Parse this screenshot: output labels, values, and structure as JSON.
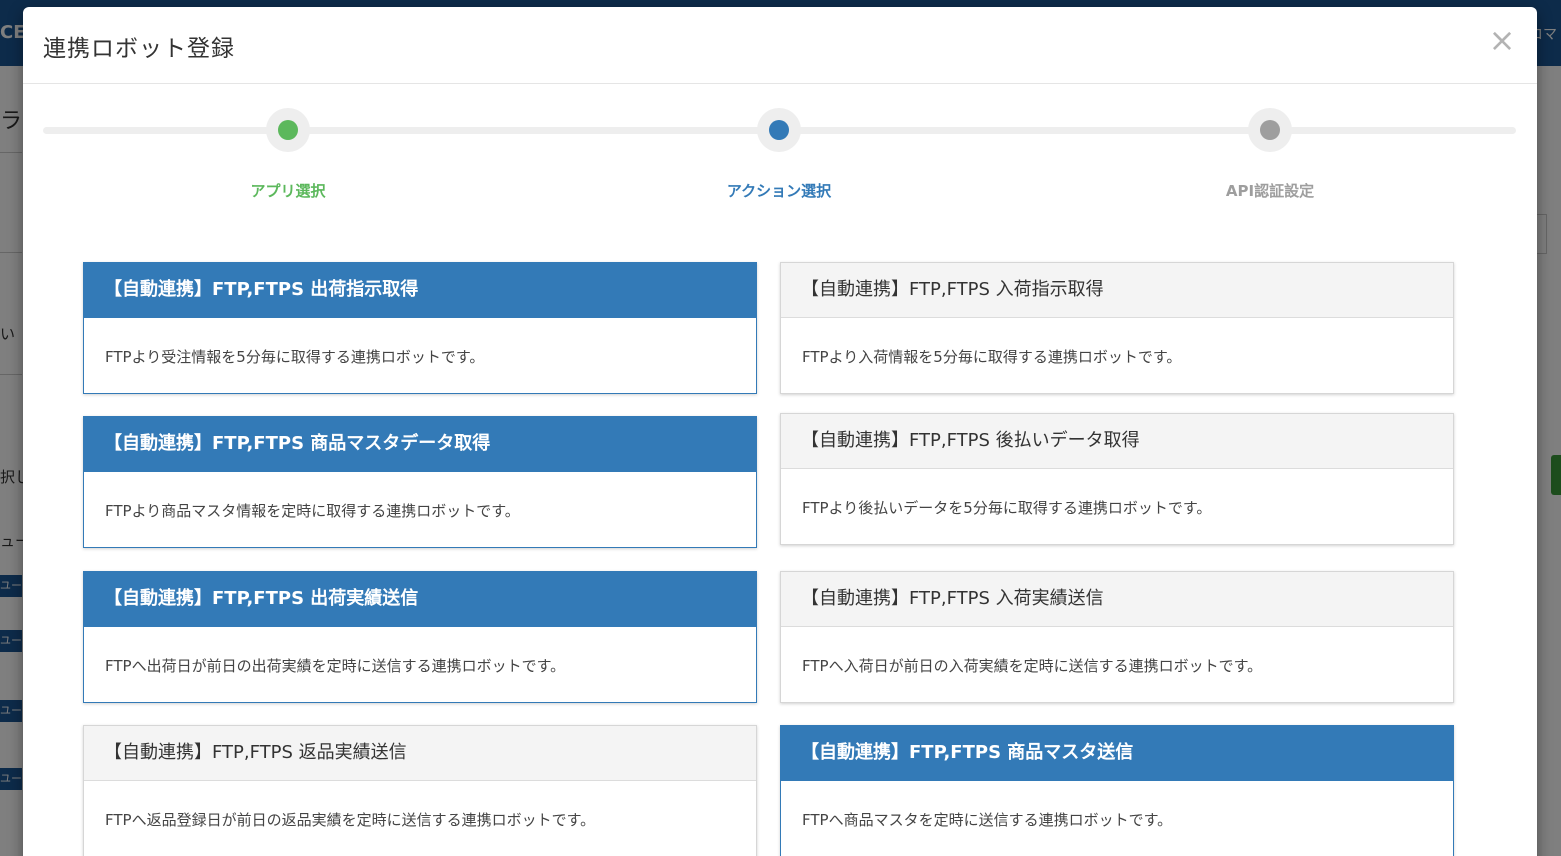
{
  "background": {
    "brand_fragment": "CE",
    "topbar_right_fragment": "コマ",
    "left_fragments": [
      "ラ",
      "い",
      "択し",
      "ュー"
    ],
    "left_badge_fragment": "ユー"
  },
  "modal": {
    "title": "連携ロボット登録",
    "close_glyph": "×"
  },
  "stepper": {
    "steps": [
      {
        "label": "アプリ選択",
        "state": "completed",
        "color": "#5cb85c"
      },
      {
        "label": "アクション選択",
        "state": "active",
        "color": "#337ab7"
      },
      {
        "label": "API認証設定",
        "state": "pending",
        "color": "#9e9e9e"
      }
    ]
  },
  "cards": [
    {
      "title": "【自動連携】FTP,FTPS 出荷指示取得",
      "description": "FTPより受注情報を5分毎に取得する連携ロボットです。",
      "selected": true
    },
    {
      "title": "【自動連携】FTP,FTPS 入荷指示取得",
      "description": "FTPより入荷情報を5分毎に取得する連携ロボットです。",
      "selected": false
    },
    {
      "title": "【自動連携】FTP,FTPS 商品マスタデータ取得",
      "description": "FTPより商品マスタ情報を定時に取得する連携ロボットです。",
      "selected": true
    },
    {
      "title": "【自動連携】FTP,FTPS 後払いデータ取得",
      "description": "FTPより後払いデータを5分毎に取得する連携ロボットです。",
      "selected": false
    },
    {
      "title": "【自動連携】FTP,FTPS 出荷実績送信",
      "description": "FTPへ出荷日が前日の出荷実績を定時に送信する連携ロボットです。",
      "selected": true
    },
    {
      "title": "【自動連携】FTP,FTPS 入荷実績送信",
      "description": "FTPへ入荷日が前日の入荷実績を定時に送信する連携ロボットです。",
      "selected": false
    },
    {
      "title": "【自動連携】FTP,FTPS 返品実績送信",
      "description": "FTPへ返品登録日が前日の返品実績を定時に送信する連携ロボットです。",
      "selected": false
    },
    {
      "title": "【自動連携】FTP,FTPS 商品マスタ送信",
      "description": "FTPへ商品マスタを定時に送信する連携ロボットです。",
      "selected": true
    }
  ]
}
